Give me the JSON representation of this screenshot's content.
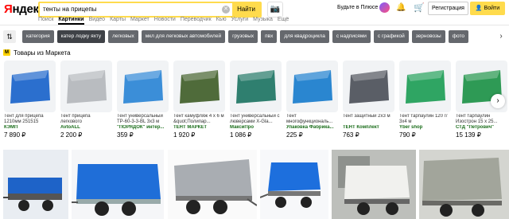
{
  "header": {
    "logo": "Яндекс",
    "query": "тенты на прицепы",
    "find": "Найти",
    "plus": "Будьте в Плюсе",
    "register": "Регистрация",
    "login": "Войти"
  },
  "tabs": [
    "Поиск",
    "Картинки",
    "Видео",
    "Карты",
    "Маркет",
    "Новости",
    "Переводчик",
    "Кью",
    "Услуги",
    "Музыка",
    "Ещё"
  ],
  "chips": [
    "категория",
    "катер лодку яхту",
    "легковых",
    "мкл для легковых автомобилей",
    "грузовых",
    "пвх",
    "для квадроцикла",
    "с надписями",
    "с графикой",
    "зерновозы",
    "фото"
  ],
  "market": {
    "title": "Товары из Маркета",
    "products": [
      {
        "name": "Тент для прицепа 1210мм 251515",
        "shop": "КЭМП",
        "price": "7 890 ₽",
        "color": "#2b6fce"
      },
      {
        "name": "Тент прицепа легкового",
        "shop": "AvtoALL",
        "price": "2 200 ₽",
        "color": "#b9bcc0"
      },
      {
        "name": "Тент универсальный ТР-60-3-3-BL 3x3 м",
        "shop": "\"ПОРЯДОК\" интер...",
        "price": "359 ₽",
        "color": "#3b8ed8"
      },
      {
        "name": "Тент камуфляж 4 х 6 м &quot;Полипар...",
        "shop": "ТЕНТ МАРКЕТ",
        "price": "1 920 ₽",
        "color": "#4f6b3a"
      },
      {
        "name": "Тент универсальный с люверсами X-Gla...",
        "shop": "МаксиПро",
        "price": "1 086 ₽",
        "color": "#2f7f6f"
      },
      {
        "name": "Тент многофункциональ...",
        "shop": "Упаковка Фабрика...",
        "price": "225 ₽",
        "color": "#2a86d0"
      },
      {
        "name": "Тент защитный 2х3 м",
        "shop": "ТЕНТ Комплект",
        "price": "763 ₽",
        "color": "#5a5e66"
      },
      {
        "name": "Тент тарпаулин 120 г/ 3х4 м",
        "shop": "Yber shop",
        "price": "790 ₽",
        "color": "#2fa563"
      },
      {
        "name": "Тент тарпаулин Изострон 15 х 25...",
        "shop": "СТД \"Петрович\"",
        "price": "15 139 ₽",
        "color": "#2e9a55"
      }
    ]
  },
  "colors": {
    "accent": "#ffdb4d",
    "chip": "#65686d",
    "shop_green": "#1a6d1a"
  },
  "icons": [
    "camera-icon",
    "bell-icon",
    "cart-icon",
    "filter-icon",
    "market-icon",
    "chevron-right-icon"
  ]
}
